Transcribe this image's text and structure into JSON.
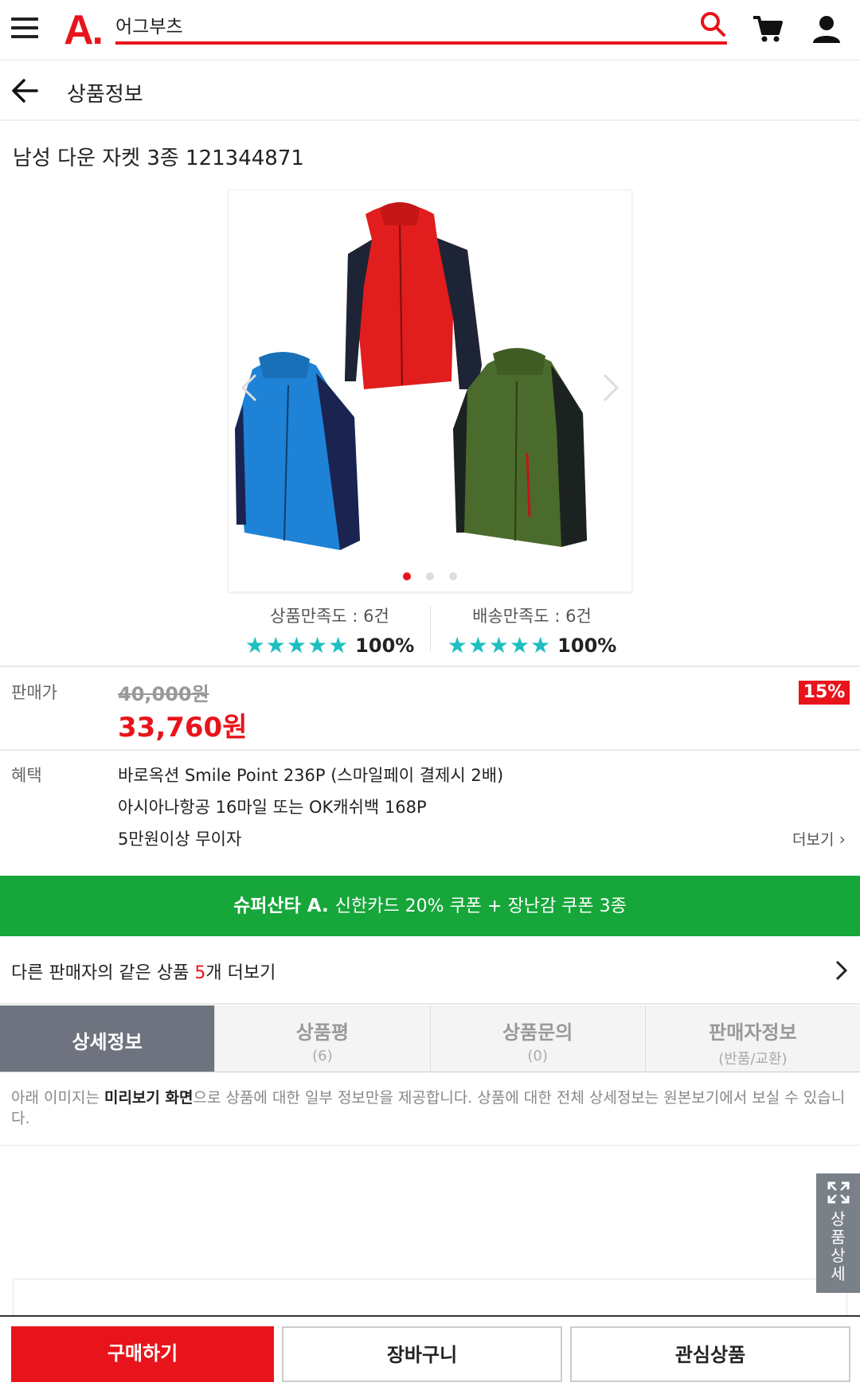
{
  "header": {
    "logo_text": "A.",
    "search_value": "어그부츠",
    "accent_color": "#e8141b"
  },
  "subheader": {
    "title": "상품정보"
  },
  "product": {
    "title": "남성 다운 자켓 3종 121344871",
    "image_alt": "down-jackets-red-blue-green",
    "carousel_page": 1,
    "carousel_total": 3
  },
  "ratings": {
    "product": {
      "label": "상품만족도 : 6건",
      "stars": "★★★★★",
      "pct": "100%"
    },
    "delivery": {
      "label": "배송만족도 : 6건",
      "stars": "★★★★★",
      "pct": "100%"
    }
  },
  "price": {
    "label": "판매가",
    "original": "40,000원",
    "sale": "33,760원",
    "discount": "15%"
  },
  "benefits": {
    "label": "혜택",
    "lines": [
      "바로옥션 Smile Point 236P (스마일페이 결제시 2배)",
      "아시아나항공 16마일 또는 OK캐쉬백 168P",
      "5만원이상 무이자"
    ],
    "more": "더보기"
  },
  "promo": {
    "brand": "슈퍼산타 A.",
    "text": "신한카드 20% 쿠폰 + 장난감 쿠폰 3종",
    "color": "#16a63a"
  },
  "other_sellers": {
    "prefix": "다른 판매자의 같은 상품 ",
    "count": "5",
    "suffix": "개 더보기"
  },
  "tabs": [
    {
      "label": "상세정보",
      "sub": ""
    },
    {
      "label": "상품평",
      "sub": "(6)"
    },
    {
      "label": "상품문의",
      "sub": "(0)"
    },
    {
      "label": "판매자정보",
      "sub": "(반품/교환)"
    }
  ],
  "notice": {
    "before": "아래 이미지는 ",
    "bold": "미리보기 화면",
    "after": "으로 상품에 대한 일부 정보만을 제공합니다. 상품에 대한 전체 상세정보는 원본보기에서 보실 수 있습니다."
  },
  "side_button": {
    "label": "상품상세"
  },
  "bottom_bar": {
    "buy": "구매하기",
    "cart": "장바구니",
    "wish": "관심상품"
  }
}
